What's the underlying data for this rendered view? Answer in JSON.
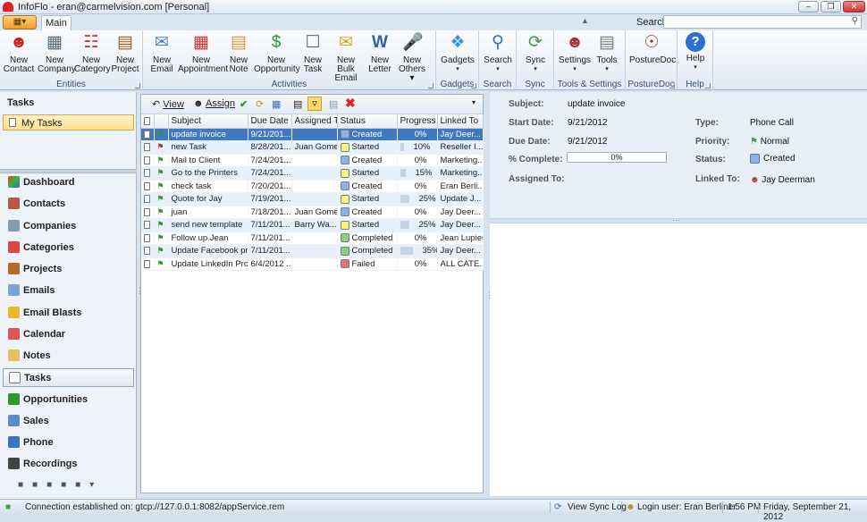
{
  "window": {
    "title": "InfoFlo - eran@carmelvision.com [Personal]"
  },
  "ribbon_tabs": {
    "main": "Main"
  },
  "search": {
    "label": "Search",
    "placeholder": ""
  },
  "ribbon": {
    "groups": [
      {
        "name": "Entities",
        "buttons": [
          {
            "l1": "New",
            "l2": "Contact"
          },
          {
            "l1": "New",
            "l2": "Company"
          },
          {
            "l1": "New",
            "l2": "Category"
          },
          {
            "l1": "New",
            "l2": "Project"
          }
        ]
      },
      {
        "name": "Activities",
        "buttons": [
          {
            "l1": "New",
            "l2": "Email"
          },
          {
            "l1": "New",
            "l2": "Appointment"
          },
          {
            "l1": "New",
            "l2": "Note"
          },
          {
            "l1": "New",
            "l2": "Opportunity"
          },
          {
            "l1": "New",
            "l2": "Task"
          },
          {
            "l1": "New",
            "l2": "Bulk Email"
          },
          {
            "l1": "New",
            "l2": "Letter"
          },
          {
            "l1": "New",
            "l2": "Others"
          }
        ]
      },
      {
        "name": "Gadgets",
        "buttons": [
          {
            "l1": "Gadgets",
            "l2": ""
          }
        ]
      },
      {
        "name": "Search",
        "buttons": [
          {
            "l1": "Search",
            "l2": ""
          }
        ]
      },
      {
        "name": "Sync",
        "buttons": [
          {
            "l1": "Sync",
            "l2": ""
          }
        ]
      },
      {
        "name": "Tools & Settings",
        "buttons": [
          {
            "l1": "Settings",
            "l2": ""
          },
          {
            "l1": "Tools",
            "l2": ""
          }
        ]
      },
      {
        "name": "PostureDoc",
        "buttons": [
          {
            "l1": "PostureDoc",
            "l2": ""
          }
        ]
      },
      {
        "name": "Help",
        "buttons": [
          {
            "l1": "Help",
            "l2": ""
          }
        ]
      }
    ]
  },
  "sidebar": {
    "header": "Tasks",
    "tree_item": "My Tasks",
    "nav": [
      "Dashboard",
      "Contacts",
      "Companies",
      "Categories",
      "Projects",
      "Emails",
      "Email Blasts",
      "Calendar",
      "Notes",
      "Tasks",
      "Opportunities",
      "Sales",
      "Phone",
      "Recordings"
    ]
  },
  "list_toolbar": {
    "view": "View",
    "assign": "Assign"
  },
  "table": {
    "columns": [
      "Subject",
      "Due Date",
      "Assigned To",
      "Status",
      "Progress",
      "Linked To"
    ],
    "rows": [
      {
        "subject": "update invoice",
        "due": "9/21/201...",
        "assigned": "",
        "status": "Created",
        "progress": "0%",
        "linked": "Jay Deer..."
      },
      {
        "subject": "new Task",
        "due": "8/28/201...",
        "assigned": "Juan Gomez",
        "status": "Started",
        "progress": "10%",
        "linked": "Reseller I..."
      },
      {
        "subject": "Mail to Client",
        "due": "7/24/201...",
        "assigned": "",
        "status": "Created",
        "progress": "0%",
        "linked": "Marketing..."
      },
      {
        "subject": "Go to the Printers",
        "due": "7/24/201...",
        "assigned": "",
        "status": "Started",
        "progress": "15%",
        "linked": "Marketing..."
      },
      {
        "subject": "check task",
        "due": "7/20/201...",
        "assigned": "",
        "status": "Created",
        "progress": "0%",
        "linked": "Eran Berli..."
      },
      {
        "subject": "Quote for Jay",
        "due": "7/19/201...",
        "assigned": "",
        "status": "Started",
        "progress": "25%",
        "linked": "Update J..."
      },
      {
        "subject": "juan",
        "due": "7/18/201...",
        "assigned": "Juan Gomez",
        "status": "Created",
        "progress": "0%",
        "linked": "Jay Deer..."
      },
      {
        "subject": "send new template",
        "due": "7/11/201...",
        "assigned": "Barry Wa...",
        "status": "Started",
        "progress": "25%",
        "linked": "Jay Deer..."
      },
      {
        "subject": "Follow up Jean",
        "due": "7/11/201...",
        "assigned": "",
        "status": "Completed",
        "progress": "0%",
        "linked": "Jean Lupien"
      },
      {
        "subject": "Update Facebook pr...",
        "due": "7/11/201...",
        "assigned": "",
        "status": "Completed",
        "progress": "35%",
        "linked": "Jay Deer..."
      },
      {
        "subject": "Update LinkedIn Profile",
        "due": "6/4/2012 ...",
        "assigned": "",
        "status": "Failed",
        "progress": "0%",
        "linked": "ALL CATE..."
      }
    ]
  },
  "detail": {
    "subject_label": "Subject:",
    "subject": "update invoice",
    "start_label": "Start Date:",
    "start": "9/21/2012",
    "due_label": "Due Date:",
    "due": "9/21/2012",
    "complete_label": "% Complete:",
    "complete": "0%",
    "assigned_label": "Assigned To:",
    "type_label": "Type:",
    "type": "Phone Call",
    "priority_label": "Priority:",
    "priority": "Normal",
    "status_label": "Status:",
    "status": "Created",
    "linked_label": "Linked To:",
    "linked": "Jay Deerman"
  },
  "statusbar": {
    "connection": "Connection established on: gtcp://127.0.0.1:8082/appService.rem",
    "sync_log": "View Sync Log",
    "login": "Login user: Eran Berliner",
    "time": "1:56 PM",
    "date": "Friday, September 21, 2012"
  },
  "colors": {
    "selected_row": "#3f78c3",
    "created": "#8fb0e8",
    "started": "#fff17a",
    "completed": "#8ed36b",
    "failed": "#ef6d6d"
  }
}
